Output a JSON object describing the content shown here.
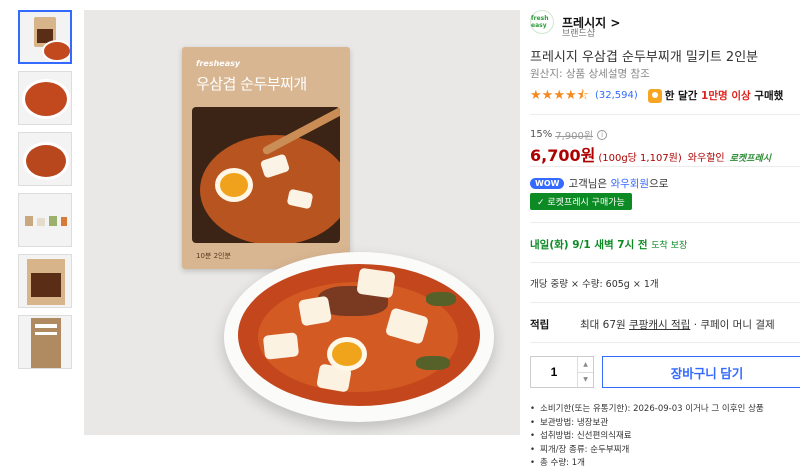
{
  "brand": {
    "logo_text": "fresh easy",
    "name": "프레시지 >",
    "sub": "브랜드샵"
  },
  "product": {
    "title": "프레시지 우삼겹 순두부찌개 밀키트 2인분",
    "origin": "원산지: 상품 상세설명 참조",
    "pouch_brand": "fresheasy",
    "pouch_title": "우삼겹 순두부찌개",
    "pouch_foot": "10분  2인분"
  },
  "rating": {
    "stars": 4.5,
    "reviews": "(32,594)",
    "buy_prefix": "한 달간",
    "buy_highlight": "1만명 이상",
    "buy_suffix": "구매했"
  },
  "price": {
    "discount": "15%",
    "original": "7,900원",
    "current": "6,700원",
    "unit": "(100g당 1,107원)",
    "wow": "와우할인",
    "rocket": "로켓프레시"
  },
  "wow": {
    "badge": "WOW",
    "text_prefix": "고객님은",
    "text_link": "와우회원",
    "text_suffix": "으로",
    "fresh_badge": "✓ 로켓프레시 구매가능"
  },
  "delivery": {
    "text": "내일(화) 9/1 새벽 7시 전",
    "guarantee": "도착 보장"
  },
  "weight": "개당 중량 × 수량: 605g × 1개",
  "points": {
    "label": "적립",
    "prefix": "최대 67원",
    "link": "쿠팡캐시 적립",
    "suffix": "· 쿠페이 머니 결제"
  },
  "cart": {
    "quantity": "1",
    "button": "장바구니 담기"
  },
  "details": [
    "소비기한(또는 유통기한): 2026-09-03 이거나 그 이후인 상품",
    "보관방법: 냉장보관",
    "섭취방법: 신선편의식재료",
    "찌개/장 종류: 순두부찌개",
    "총 수량: 1개"
  ],
  "colors": {
    "accent": "#346aff",
    "price": "#ae0000",
    "fresh": "#0c8a24",
    "star": "#f48a1f"
  }
}
